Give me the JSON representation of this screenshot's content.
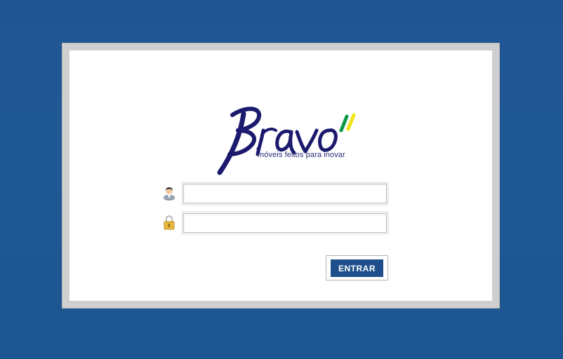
{
  "brand": {
    "name": "Bravo",
    "tagline": "móveis feitos para inovar",
    "logo_color": "#1c1a6e",
    "accent_colors": [
      "#0e9b48",
      "#f2e318"
    ]
  },
  "login": {
    "username_value": "",
    "username_icon": "user-icon",
    "password_value": "",
    "password_icon": "lock-icon",
    "submit_label": "ENTRAR"
  },
  "colors": {
    "background": "#205896",
    "frame": "#cfcfcf",
    "panel": "#ffffff",
    "button": "#1e4f8c"
  }
}
